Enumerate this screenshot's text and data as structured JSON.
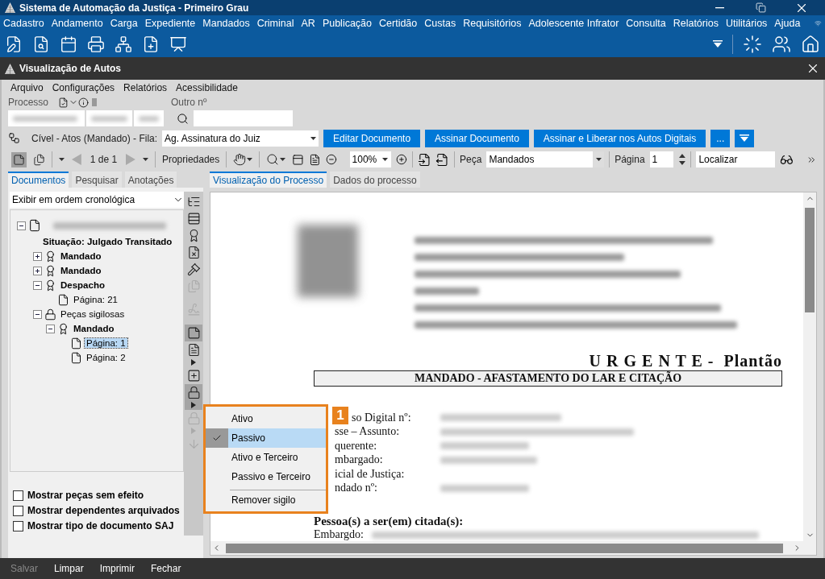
{
  "app_title": "Sistema de Automação da Justiça - Primeiro Grau",
  "main_menu": [
    "Cadastro",
    "Andamento",
    "Carga",
    "Expediente",
    "Mandados",
    "Criminal",
    "AR",
    "Publicação",
    "Certidão",
    "Custas",
    "Requisitórios",
    "Adolescente Infrator",
    "Consulta",
    "Relatórios",
    "Utilitários",
    "Ajuda"
  ],
  "window": {
    "title": "Visualização de Autos"
  },
  "window_menu": [
    "Arquivo",
    "Configurações",
    "Relatórios",
    "Acessibilidade"
  ],
  "process": {
    "label": "Processo",
    "other_label": "Outro nº"
  },
  "queue": {
    "label": "Cível - Atos (Mandado) - Fila:",
    "value": "Ag. Assinatura do Juiz"
  },
  "action_buttons": [
    "Editar Documento",
    "Assinar Documento",
    "Assinar e Liberar nos Autos Digitais",
    "..."
  ],
  "viewer_toolbar": {
    "page_count": "1 de 1",
    "properties": "Propriedades",
    "zoom": "100%",
    "piece_label": "Peça",
    "piece": "Mandados",
    "page_label": "Página",
    "page": "1",
    "find": "Localizar"
  },
  "left_tabs": [
    {
      "label": "Documentos",
      "selected": true
    },
    {
      "label": "Pesquisar",
      "selected": false
    },
    {
      "label": "Anotações",
      "selected": false
    }
  ],
  "order_select": "Exibir em ordem cronológica",
  "tree": {
    "status": "Situação: Julgado Transitado",
    "expanded": true,
    "children": [
      {
        "label": "Mandado",
        "kind": "certificate",
        "expanded": false,
        "selected": false
      },
      {
        "label": "Mandado",
        "kind": "certificate",
        "expanded": false,
        "selected": false
      },
      {
        "label": "Despacho",
        "kind": "certificate",
        "expanded": true,
        "selected": false,
        "children": [
          {
            "label": "Página: 21",
            "kind": "page",
            "selected": false
          }
        ]
      },
      {
        "label": "Peças sigilosas",
        "kind": "lock",
        "expanded": true,
        "selected": false,
        "children": [
          {
            "label": "Mandado",
            "kind": "certificate",
            "expanded": true,
            "selected": false,
            "children": [
              {
                "label": "Página: 1",
                "kind": "page",
                "selected": true
              },
              {
                "label": "Página: 2",
                "kind": "page",
                "selected": false
              }
            ]
          }
        ]
      }
    ]
  },
  "tools": [
    {
      "kind": "tree",
      "active": false,
      "disabled": false
    },
    {
      "kind": "rows",
      "active": false,
      "disabled": false
    },
    {
      "kind": "certificate",
      "active": false,
      "disabled": false
    },
    {
      "kind": "file-x",
      "active": false,
      "disabled": false
    },
    {
      "kind": "gavel",
      "active": false,
      "disabled": false
    },
    {
      "kind": "copy",
      "active": false,
      "disabled": true
    },
    {
      "kind": "sign",
      "active": false,
      "disabled": true
    },
    {
      "kind": "note",
      "active": true,
      "disabled": false
    },
    {
      "kind": "note-list",
      "active": false,
      "disabled": false,
      "menu": true
    },
    {
      "kind": "add-note",
      "active": false,
      "disabled": false
    },
    {
      "kind": "lock",
      "active": true,
      "disabled": false,
      "menu": true
    },
    {
      "kind": "lock",
      "active": false,
      "disabled": true,
      "menu": true
    },
    {
      "kind": "download",
      "active": false,
      "disabled": true
    }
  ],
  "checkboxes": [
    {
      "label": "Mostrar peças sem efeito",
      "checked": false
    },
    {
      "label": "Mostrar dependentes arquivados",
      "checked": false
    },
    {
      "label": "Mostrar tipo de documento SAJ",
      "checked": false
    }
  ],
  "right_tabs": [
    {
      "label": "Visualização do Processo",
      "selected": true
    },
    {
      "label": "Dados do processo",
      "selected": false
    }
  ],
  "document": {
    "heading": "U R G E N T E -  Plantão",
    "title": "MANDADO - AFASTAMENTO DO LAR E CITAÇÃO",
    "fields": [
      "so Digital nº:",
      "sse – Assunto:",
      "querente:",
      "mbargado:",
      "icial de Justiça:",
      "ndado nº:"
    ],
    "section": "Pessoa(s) a ser(em) citada(s):",
    "section_field": "Embargdo:"
  },
  "context_menu": [
    {
      "label": "Ativo",
      "kind": "option",
      "checked": false,
      "selected": false
    },
    {
      "label": "Passivo",
      "kind": "option",
      "checked": true,
      "selected": true
    },
    {
      "label": "Ativo e Terceiro",
      "kind": "option",
      "checked": false,
      "selected": false
    },
    {
      "label": "Passivo e Terceiro",
      "kind": "option",
      "checked": false,
      "selected": false
    },
    {
      "label": "Remover sigilo",
      "kind": "action",
      "selected": false
    }
  ],
  "callout": "1",
  "footer_buttons": [
    {
      "label": "Salvar",
      "disabled": true
    },
    {
      "label": "Limpar",
      "disabled": false
    },
    {
      "label": "Imprimir",
      "disabled": false
    },
    {
      "label": "Fechar",
      "disabled": false
    }
  ]
}
